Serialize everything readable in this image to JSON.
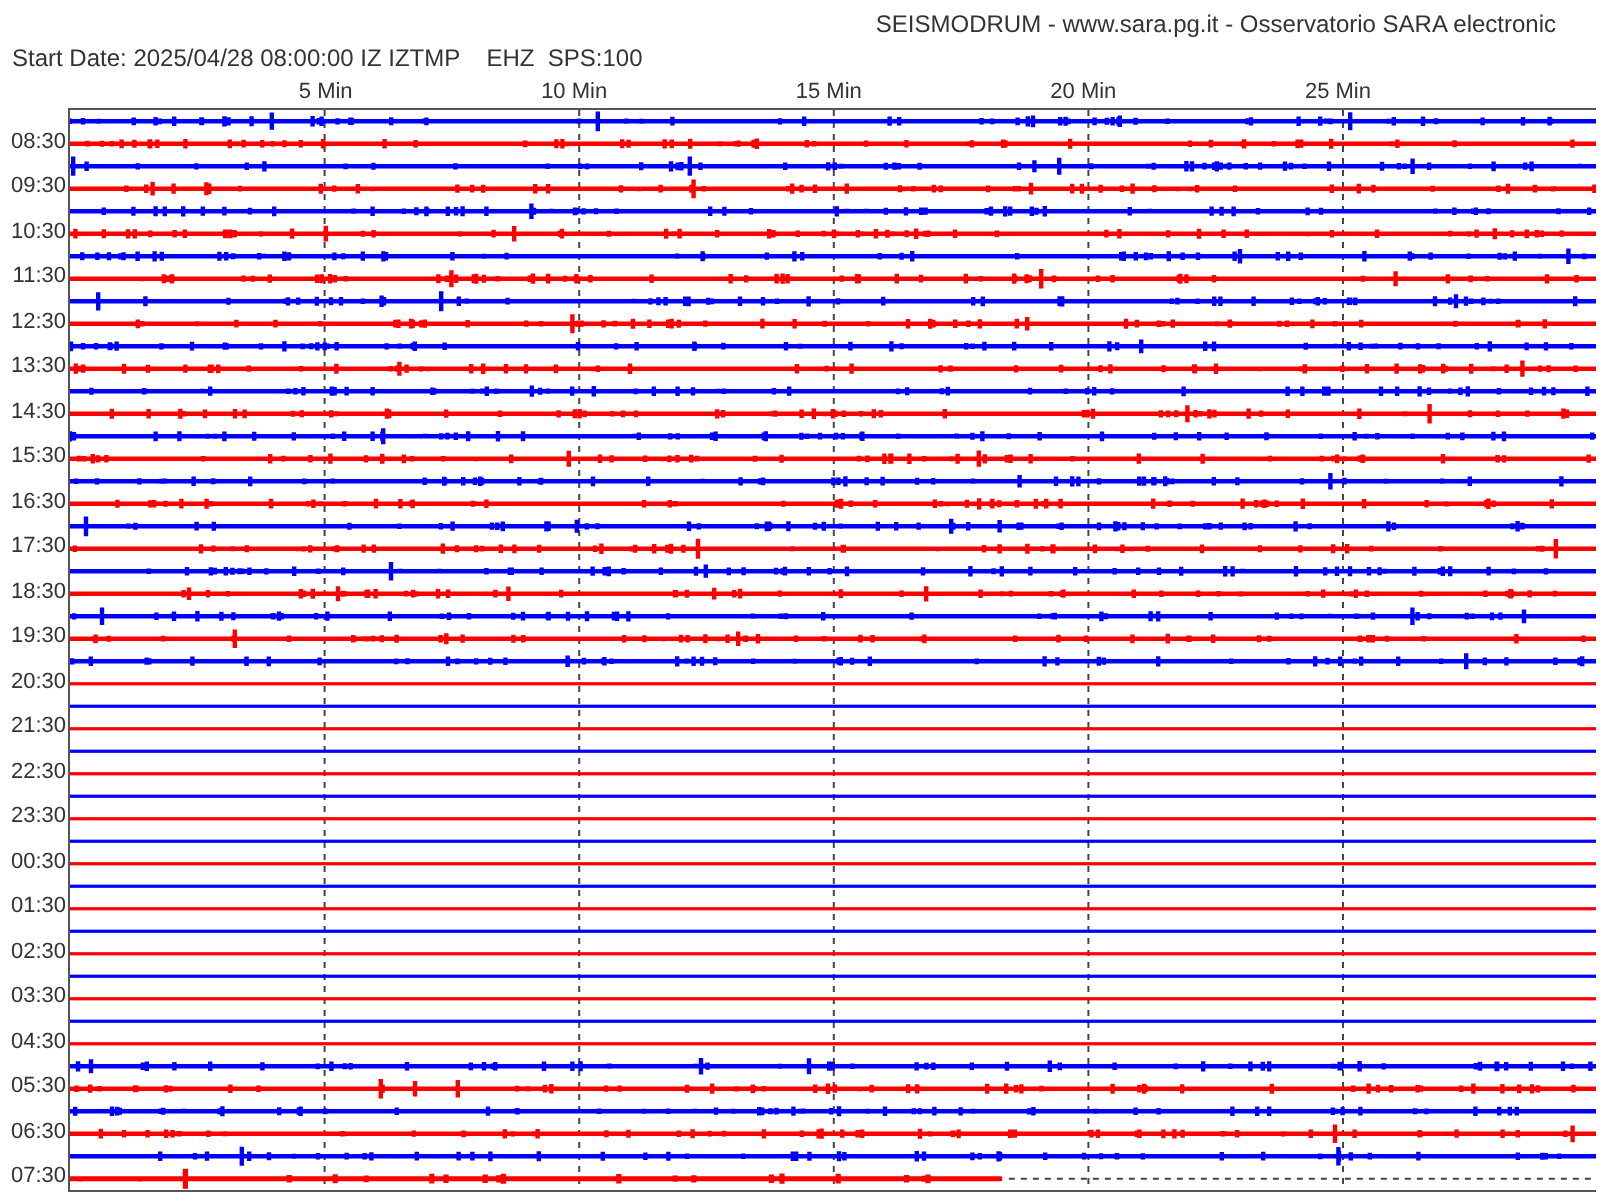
{
  "title": "SEISMODRUM - www.sara.pg.it - Osservatorio SARA electronic",
  "start_info": "Start Date: 2025/04/28 08:00:00 IZ IZTMP    EHZ  SPS:100",
  "x_ticks": [
    "5 Min",
    "10 Min",
    "15 Min",
    "20 Min",
    "25 Min"
  ],
  "rows": [
    {
      "color": "#0000ff",
      "kind": "active"
    },
    {
      "color": "#ff0000",
      "kind": "active",
      "label": "08:30"
    },
    {
      "color": "#0000ff",
      "kind": "active"
    },
    {
      "color": "#ff0000",
      "kind": "active",
      "label": "09:30"
    },
    {
      "color": "#0000ff",
      "kind": "active"
    },
    {
      "color": "#ff0000",
      "kind": "active",
      "label": "10:30"
    },
    {
      "color": "#0000ff",
      "kind": "active"
    },
    {
      "color": "#ff0000",
      "kind": "active",
      "label": "11:30"
    },
    {
      "color": "#0000ff",
      "kind": "active"
    },
    {
      "color": "#ff0000",
      "kind": "active",
      "label": "12:30"
    },
    {
      "color": "#0000ff",
      "kind": "active"
    },
    {
      "color": "#ff0000",
      "kind": "active",
      "label": "13:30"
    },
    {
      "color": "#0000ff",
      "kind": "active"
    },
    {
      "color": "#ff0000",
      "kind": "active",
      "label": "14:30"
    },
    {
      "color": "#0000ff",
      "kind": "active"
    },
    {
      "color": "#ff0000",
      "kind": "active",
      "label": "15:30"
    },
    {
      "color": "#0000ff",
      "kind": "active"
    },
    {
      "color": "#ff0000",
      "kind": "active",
      "label": "16:30"
    },
    {
      "color": "#0000ff",
      "kind": "active"
    },
    {
      "color": "#ff0000",
      "kind": "active",
      "label": "17:30"
    },
    {
      "color": "#0000ff",
      "kind": "active"
    },
    {
      "color": "#ff0000",
      "kind": "active",
      "label": "18:30"
    },
    {
      "color": "#0000ff",
      "kind": "active"
    },
    {
      "color": "#ff0000",
      "kind": "active",
      "label": "19:30"
    },
    {
      "color": "#0000ff",
      "kind": "active"
    },
    {
      "color": "#ff0000",
      "kind": "quiet",
      "label": "20:30"
    },
    {
      "color": "#0000ff",
      "kind": "quiet"
    },
    {
      "color": "#ff0000",
      "kind": "quiet",
      "label": "21:30"
    },
    {
      "color": "#0000ff",
      "kind": "quiet"
    },
    {
      "color": "#ff0000",
      "kind": "quiet",
      "label": "22:30"
    },
    {
      "color": "#0000ff",
      "kind": "quiet"
    },
    {
      "color": "#ff0000",
      "kind": "quiet",
      "label": "23:30"
    },
    {
      "color": "#0000ff",
      "kind": "quiet"
    },
    {
      "color": "#ff0000",
      "kind": "quiet",
      "label": "00:30"
    },
    {
      "color": "#0000ff",
      "kind": "quiet"
    },
    {
      "color": "#ff0000",
      "kind": "quiet",
      "label": "01:30"
    },
    {
      "color": "#0000ff",
      "kind": "quiet"
    },
    {
      "color": "#ff0000",
      "kind": "quiet",
      "label": "02:30"
    },
    {
      "color": "#0000ff",
      "kind": "quiet"
    },
    {
      "color": "#ff0000",
      "kind": "quiet",
      "label": "03:30"
    },
    {
      "color": "#0000ff",
      "kind": "quiet"
    },
    {
      "color": "#ff0000",
      "kind": "quiet",
      "label": "04:30"
    },
    {
      "color": "#0000ff",
      "kind": "active"
    },
    {
      "color": "#ff0000",
      "kind": "active",
      "label": "05:30"
    },
    {
      "color": "#0000ff",
      "kind": "active"
    },
    {
      "color": "#ff0000",
      "kind": "active",
      "label": "06:30"
    },
    {
      "color": "#0000ff",
      "kind": "active"
    },
    {
      "color": "#ff0000",
      "kind": "partial",
      "label": "07:30"
    }
  ]
}
